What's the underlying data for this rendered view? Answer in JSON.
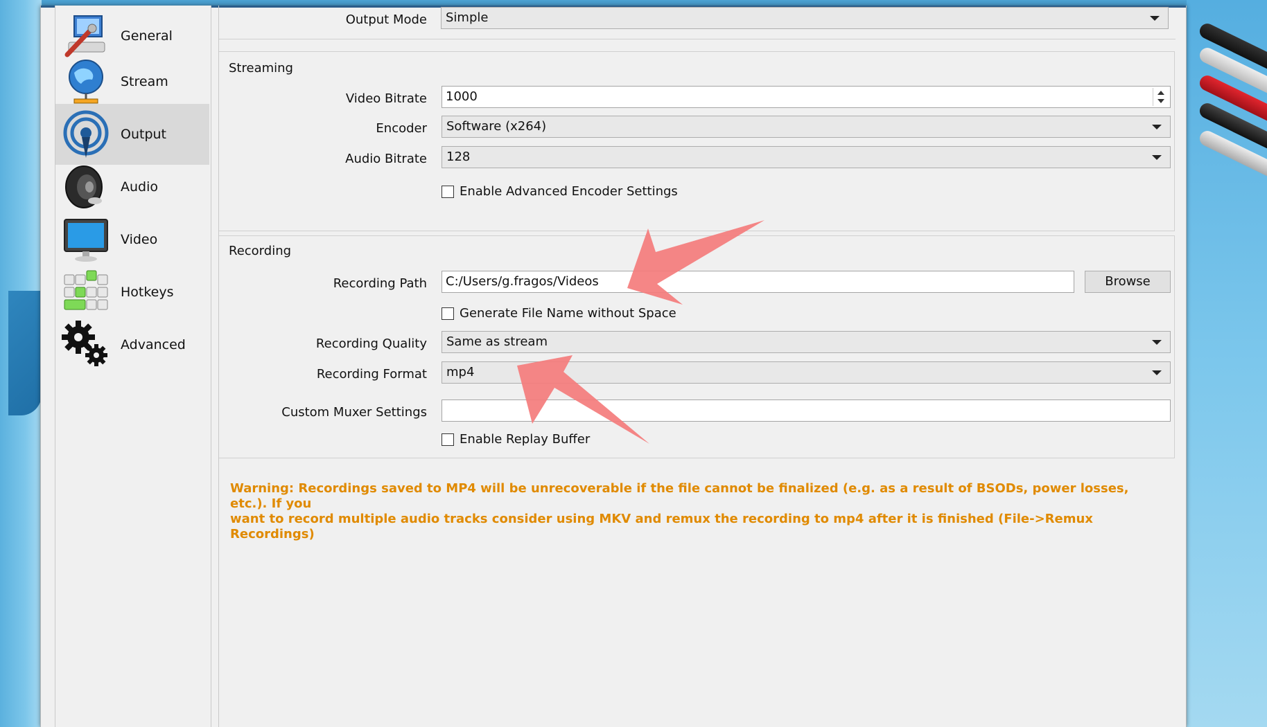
{
  "sidebar": {
    "items": [
      {
        "label": "General",
        "icon": "general-icon",
        "active": false
      },
      {
        "label": "Stream",
        "icon": "globe-icon",
        "active": false
      },
      {
        "label": "Output",
        "icon": "broadcast-icon",
        "active": true
      },
      {
        "label": "Audio",
        "icon": "speaker-icon",
        "active": false
      },
      {
        "label": "Video",
        "icon": "monitor-icon",
        "active": false
      },
      {
        "label": "Hotkeys",
        "icon": "keyboard-icon",
        "active": false
      },
      {
        "label": "Advanced",
        "icon": "gears-icon",
        "active": false
      }
    ]
  },
  "output": {
    "mode_label": "Output Mode",
    "mode_value": "Simple"
  },
  "streaming": {
    "title": "Streaming",
    "video_bitrate_label": "Video Bitrate",
    "video_bitrate_value": "1000",
    "encoder_label": "Encoder",
    "encoder_value": "Software (x264)",
    "audio_bitrate_label": "Audio Bitrate",
    "audio_bitrate_value": "128",
    "advanced_encoder_label": "Enable Advanced Encoder Settings"
  },
  "recording": {
    "title": "Recording",
    "path_label": "Recording Path",
    "path_value": "C:/Users/g.fragos/Videos",
    "browse_label": "Browse",
    "generate_filename_label": "Generate File Name without Space",
    "quality_label": "Recording Quality",
    "quality_value": "Same as stream",
    "format_label": "Recording Format",
    "format_value": "mp4",
    "muxer_label": "Custom Muxer Settings",
    "muxer_value": "",
    "replay_buffer_label": "Enable Replay Buffer"
  },
  "warning": {
    "line1": "Warning: Recordings saved to MP4 will be unrecoverable if the file cannot be finalized (e.g. as a result of BSODs, power losses, etc.). If you",
    "line2": "want to record multiple audio tracks consider using MKV and remux the recording to mp4 after it is finished (File->Remux Recordings)",
    "color": "#e08a00"
  },
  "colors": {
    "annotation_arrow": "#f47c7c",
    "active_item_bg": "#d9d9d9"
  }
}
